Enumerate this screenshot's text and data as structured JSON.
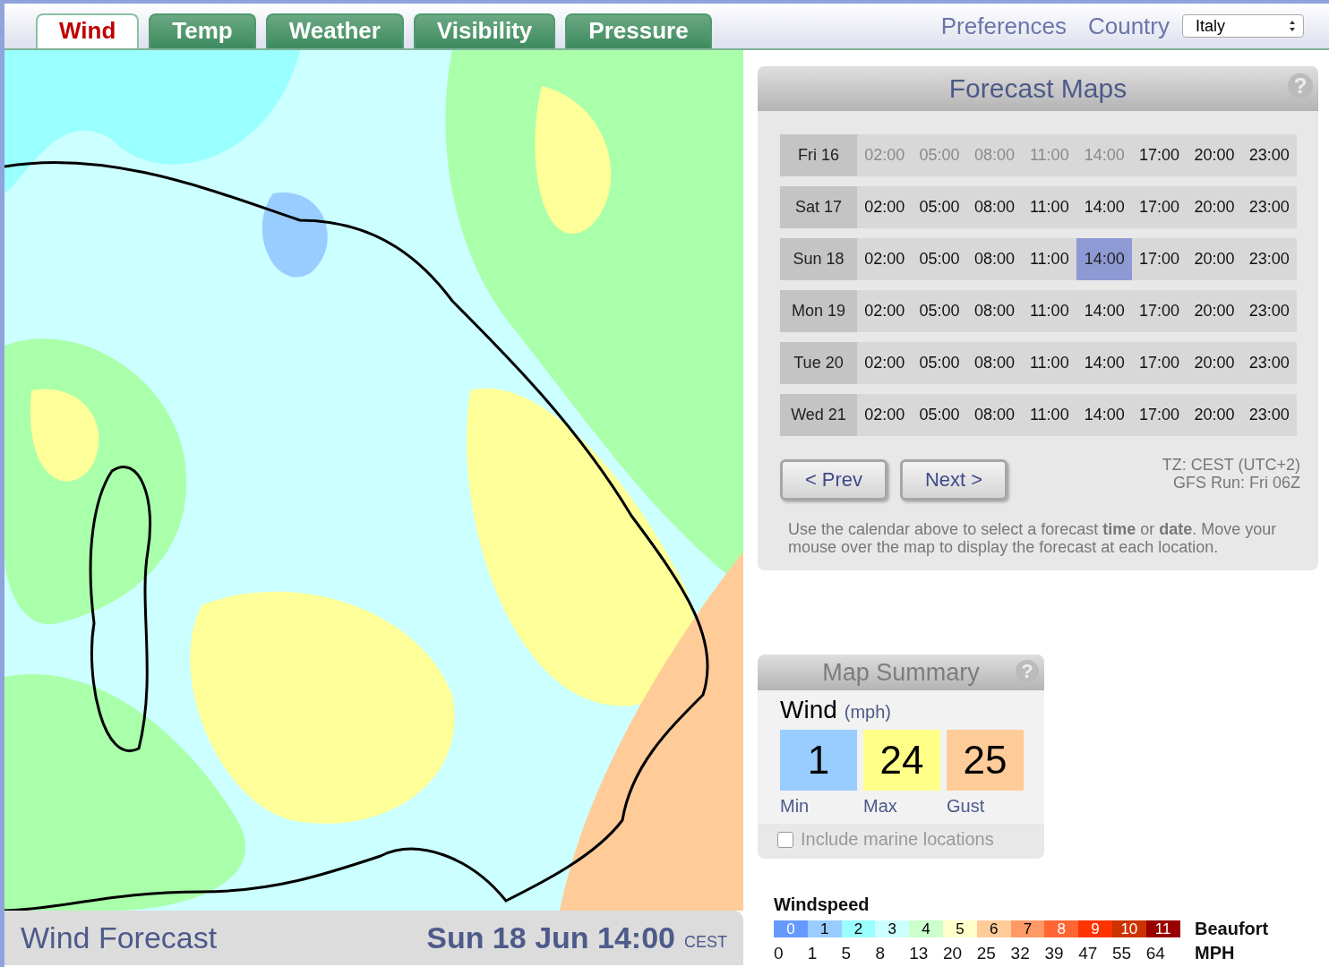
{
  "tabs": [
    {
      "label": "Wind",
      "selected": true
    },
    {
      "label": "Temp",
      "selected": false
    },
    {
      "label": "Weather",
      "selected": false
    },
    {
      "label": "Visibility",
      "selected": false
    },
    {
      "label": "Pressure",
      "selected": false
    }
  ],
  "header_links": {
    "preferences": "Preferences",
    "country_label": "Country",
    "country": "Italy"
  },
  "map": {
    "footer_title": "Wind Forecast",
    "footer_time": "Sun 18 Jun 14:00",
    "footer_tz": "CEST"
  },
  "forecast_maps": {
    "title": "Forecast Maps",
    "help": "?",
    "days": [
      {
        "day": "Fri 16",
        "times": [
          {
            "label": "02:00",
            "disabled": true,
            "selected": false
          },
          {
            "label": "05:00",
            "disabled": true,
            "selected": false
          },
          {
            "label": "08:00",
            "disabled": true,
            "selected": false
          },
          {
            "label": "11:00",
            "disabled": true,
            "selected": false
          },
          {
            "label": "14:00",
            "disabled": true,
            "selected": false
          },
          {
            "label": "17:00",
            "disabled": false,
            "selected": false
          },
          {
            "label": "20:00",
            "disabled": false,
            "selected": false
          },
          {
            "label": "23:00",
            "disabled": false,
            "selected": false
          }
        ]
      },
      {
        "day": "Sat 17",
        "times": [
          {
            "label": "02:00",
            "disabled": false,
            "selected": false
          },
          {
            "label": "05:00",
            "disabled": false,
            "selected": false
          },
          {
            "label": "08:00",
            "disabled": false,
            "selected": false
          },
          {
            "label": "11:00",
            "disabled": false,
            "selected": false
          },
          {
            "label": "14:00",
            "disabled": false,
            "selected": false
          },
          {
            "label": "17:00",
            "disabled": false,
            "selected": false
          },
          {
            "label": "20:00",
            "disabled": false,
            "selected": false
          },
          {
            "label": "23:00",
            "disabled": false,
            "selected": false
          }
        ]
      },
      {
        "day": "Sun 18",
        "times": [
          {
            "label": "02:00",
            "disabled": false,
            "selected": false
          },
          {
            "label": "05:00",
            "disabled": false,
            "selected": false
          },
          {
            "label": "08:00",
            "disabled": false,
            "selected": false
          },
          {
            "label": "11:00",
            "disabled": false,
            "selected": false
          },
          {
            "label": "14:00",
            "disabled": false,
            "selected": true
          },
          {
            "label": "17:00",
            "disabled": false,
            "selected": false
          },
          {
            "label": "20:00",
            "disabled": false,
            "selected": false
          },
          {
            "label": "23:00",
            "disabled": false,
            "selected": false
          }
        ]
      },
      {
        "day": "Mon 19",
        "times": [
          {
            "label": "02:00",
            "disabled": false,
            "selected": false
          },
          {
            "label": "05:00",
            "disabled": false,
            "selected": false
          },
          {
            "label": "08:00",
            "disabled": false,
            "selected": false
          },
          {
            "label": "11:00",
            "disabled": false,
            "selected": false
          },
          {
            "label": "14:00",
            "disabled": false,
            "selected": false
          },
          {
            "label": "17:00",
            "disabled": false,
            "selected": false
          },
          {
            "label": "20:00",
            "disabled": false,
            "selected": false
          },
          {
            "label": "23:00",
            "disabled": false,
            "selected": false
          }
        ]
      },
      {
        "day": "Tue 20",
        "times": [
          {
            "label": "02:00",
            "disabled": false,
            "selected": false
          },
          {
            "label": "05:00",
            "disabled": false,
            "selected": false
          },
          {
            "label": "08:00",
            "disabled": false,
            "selected": false
          },
          {
            "label": "11:00",
            "disabled": false,
            "selected": false
          },
          {
            "label": "14:00",
            "disabled": false,
            "selected": false
          },
          {
            "label": "17:00",
            "disabled": false,
            "selected": false
          },
          {
            "label": "20:00",
            "disabled": false,
            "selected": false
          },
          {
            "label": "23:00",
            "disabled": false,
            "selected": false
          }
        ]
      },
      {
        "day": "Wed 21",
        "times": [
          {
            "label": "02:00",
            "disabled": false,
            "selected": false
          },
          {
            "label": "05:00",
            "disabled": false,
            "selected": false
          },
          {
            "label": "08:00",
            "disabled": false,
            "selected": false
          },
          {
            "label": "11:00",
            "disabled": false,
            "selected": false
          },
          {
            "label": "14:00",
            "disabled": false,
            "selected": false
          },
          {
            "label": "17:00",
            "disabled": false,
            "selected": false
          },
          {
            "label": "20:00",
            "disabled": false,
            "selected": false
          },
          {
            "label": "23:00",
            "disabled": false,
            "selected": false
          }
        ]
      }
    ],
    "prev": "< Prev",
    "next": "Next >",
    "tz": "TZ: CEST (UTC+2)",
    "run": "GFS Run: Fri 06Z",
    "help_text": "Use the calendar above to select a forecast **time** or **date**. Move your mouse over the map to display the forecast at each location."
  },
  "map_summary": {
    "title": "Map Summary",
    "help": "?",
    "measure": "Wind",
    "unit": "(mph)",
    "stats": [
      {
        "value": "1",
        "label": "Min",
        "color": "#99ccff"
      },
      {
        "value": "24",
        "label": "Max",
        "color": "#ffff88"
      },
      {
        "value": "25",
        "label": "Gust",
        "color": "#ffcc99"
      }
    ],
    "marine": {
      "label": "Include marine locations",
      "checked": false
    }
  },
  "legend": {
    "title": "Windspeed",
    "scale_label": "Beaufort",
    "unit_label": "MPH",
    "beaufort": [
      {
        "label": "0",
        "color": "#6699ff"
      },
      {
        "label": "1",
        "color": "#99ccff"
      },
      {
        "label": "2",
        "color": "#99ffff"
      },
      {
        "label": "3",
        "color": "#ccffff"
      },
      {
        "label": "4",
        "color": "#ccffcc"
      },
      {
        "label": "5",
        "color": "#ffffcc"
      },
      {
        "label": "6",
        "color": "#ffcc99"
      },
      {
        "label": "7",
        "color": "#ff9966"
      },
      {
        "label": "8",
        "color": "#ff6633"
      },
      {
        "label": "9",
        "color": "#ff3300"
      },
      {
        "label": "10",
        "color": "#cc3300"
      },
      {
        "label": "11",
        "color": "#990000"
      }
    ],
    "mph": [
      "0",
      "1",
      "5",
      "8",
      "13",
      "20",
      "25",
      "32",
      "39",
      "47",
      "55",
      "64"
    ]
  }
}
